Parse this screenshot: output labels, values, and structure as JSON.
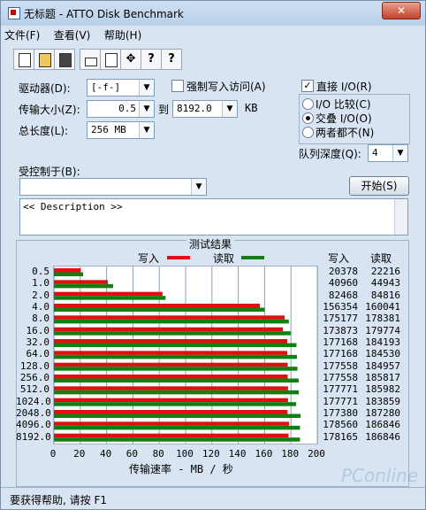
{
  "window": {
    "title": "无标题 - ATTO Disk Benchmark",
    "close": "✕"
  },
  "menu": [
    "文件(F)",
    "查看(V)",
    "帮助(H)"
  ],
  "toolbar_icons": [
    "new-icon",
    "open-icon",
    "save-icon",
    "print-icon",
    "print-preview-icon",
    "move-icon",
    "help-icon",
    "context-help-icon"
  ],
  "form": {
    "drive_label": "驱动器(D):",
    "drive_value": "[-f-]",
    "transfer_label": "传输大小(Z):",
    "transfer_from": "0.5",
    "to_label": "到",
    "transfer_to": "8192.0",
    "kb_label": "KB",
    "total_label": "总长度(L):",
    "total_value": "256 MB",
    "force_write_label": "强制写入访问(A)",
    "direct_io_label": "直接 I/O(R)",
    "direct_io_checked": true,
    "io_compare_label": "I/O 比较(C)",
    "overlapped_label": "交叠 I/O(O)",
    "neither_label": "两者都不(N)",
    "queue_label": "队列深度(Q):",
    "queue_value": "4",
    "controlled_label": "受控制于(B):",
    "controlled_value": "",
    "start_label": "开始(S)",
    "description": "<< Description >>"
  },
  "results": {
    "title": "测试结果",
    "legend_write": "写入",
    "legend_read": "读取",
    "col_write": "写入",
    "col_read": "读取",
    "x_label": "传输速率 - MB / 秒"
  },
  "chart_data": {
    "type": "bar",
    "orientation": "horizontal",
    "categories": [
      "0.5",
      "1.0",
      "2.0",
      "4.0",
      "8.0",
      "16.0",
      "32.0",
      "64.0",
      "128.0",
      "256.0",
      "512.0",
      "1024.0",
      "2048.0",
      "4096.0",
      "8192.0"
    ],
    "series": [
      {
        "name": "写入",
        "color": "#e01010",
        "values": [
          20378,
          40960,
          82468,
          156354,
          175177,
          173873,
          177168,
          177168,
          177558,
          177558,
          177771,
          177771,
          177380,
          178560,
          178165
        ]
      },
      {
        "name": "读取",
        "color": "#108010",
        "values": [
          22216,
          44943,
          84816,
          160041,
          178381,
          179774,
          184193,
          184530,
          184957,
          185817,
          185982,
          183859,
          187280,
          186846,
          186846
        ]
      }
    ],
    "xlim": [
      0,
      200
    ],
    "xticks": [
      0,
      20,
      40,
      60,
      80,
      100,
      120,
      140,
      160,
      180,
      200
    ],
    "value_unit": "KB/s",
    "grid": true
  },
  "status": {
    "text": "要获得帮助, 请按 F1"
  },
  "watermark": "PConline"
}
